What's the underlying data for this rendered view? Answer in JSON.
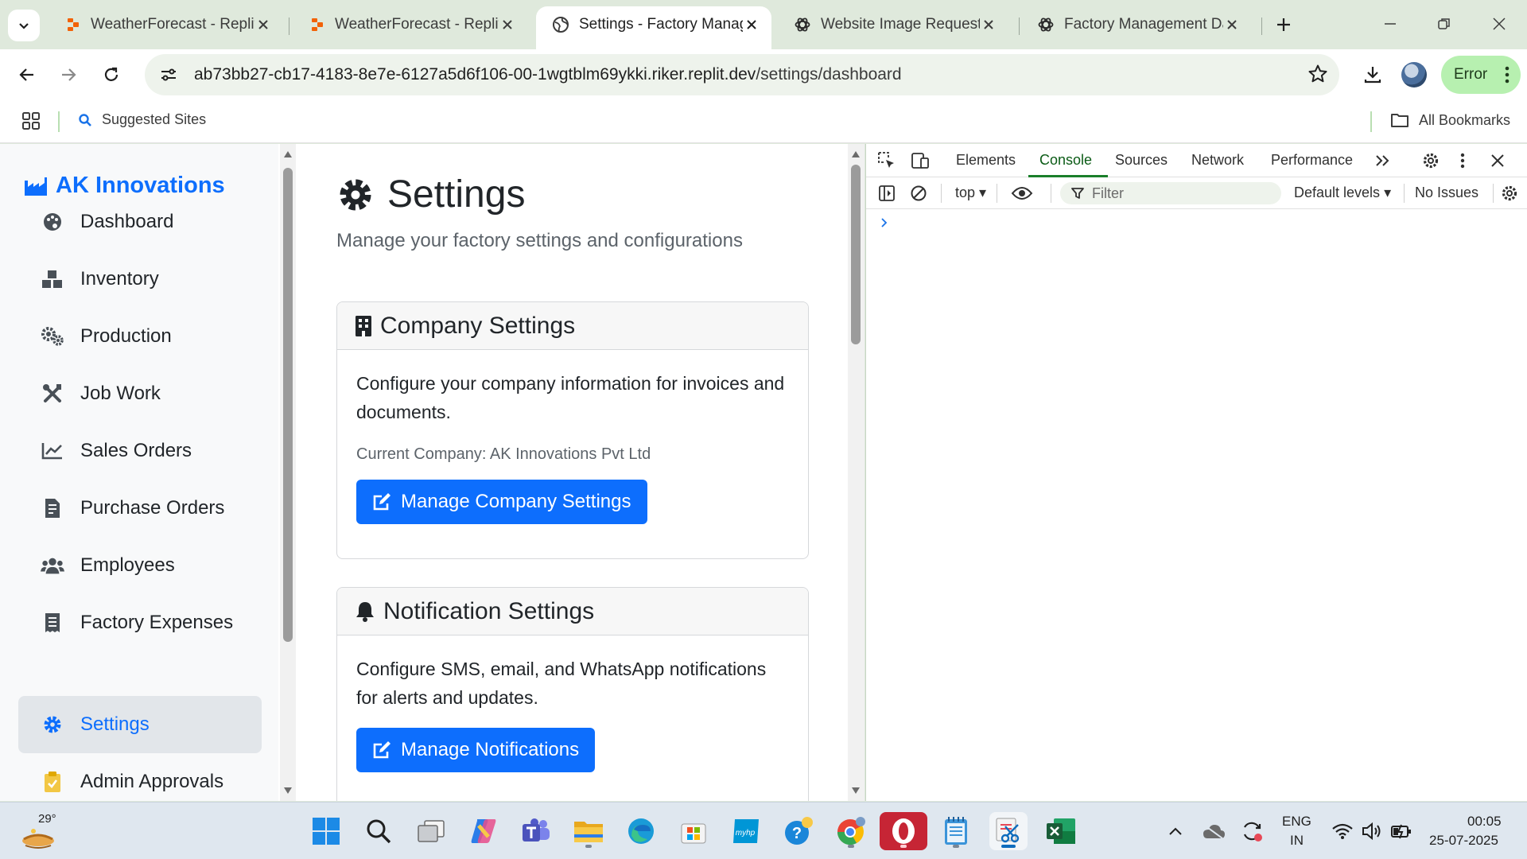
{
  "browser": {
    "tabs": [
      {
        "title": "WeatherForecast - Replit",
        "icon": "replit-icon",
        "active": false
      },
      {
        "title": "WeatherForecast - Replit",
        "icon": "replit-icon",
        "active": false
      },
      {
        "title": "Settings - Factory Manag",
        "icon": "globe-icon",
        "active": true
      },
      {
        "title": "Website Image Request",
        "icon": "chatgpt-icon",
        "active": false
      },
      {
        "title": "Factory Management Dat",
        "icon": "chatgpt-icon",
        "active": false
      }
    ],
    "url_host": "ab73bb27-cb17-4183-8e7e-6127a5d6f106-00-1wgtblm69ykki.riker.replit.dev",
    "url_path": "/settings/dashboard",
    "error_label": "Error",
    "bookmarks": {
      "suggested": "Suggested Sites",
      "all": "All Bookmarks"
    }
  },
  "app": {
    "brand": "AK Innovations",
    "nav": [
      {
        "label": "Dashboard",
        "icon": "palette-icon"
      },
      {
        "label": "Inventory",
        "icon": "boxes-icon"
      },
      {
        "label": "Production",
        "icon": "gears-icon"
      },
      {
        "label": "Job Work",
        "icon": "tools-icon"
      },
      {
        "label": "Sales Orders",
        "icon": "chart-line-icon"
      },
      {
        "label": "Purchase Orders",
        "icon": "file-invoice-icon"
      },
      {
        "label": "Employees",
        "icon": "users-icon"
      },
      {
        "label": "Factory Expenses",
        "icon": "receipt-icon"
      },
      {
        "label": "Settings",
        "icon": "gear-icon",
        "active": true
      },
      {
        "label": "Admin Approvals",
        "icon": "clipboard-check-icon"
      }
    ],
    "page_title": "Settings",
    "page_subtitle": "Manage your factory settings and configurations",
    "cards": {
      "company": {
        "title": "Company Settings",
        "text": "Configure your company information for invoices and documents.",
        "current": "Current Company: AK Innovations Pvt Ltd",
        "button": "Manage Company Settings"
      },
      "notifications": {
        "title": "Notification Settings",
        "text": "Configure SMS, email, and WhatsApp notifications for alerts and updates.",
        "button": "Manage Notifications"
      }
    }
  },
  "devtools": {
    "tabs": [
      "Elements",
      "Console",
      "Sources",
      "Network",
      "Performance"
    ],
    "active_tab": "Console",
    "context": "top",
    "filter_placeholder": "Filter",
    "levels": "Default levels",
    "issues": "No Issues"
  },
  "taskbar": {
    "temperature": "29°",
    "lang_top": "ENG",
    "lang_bottom": "IN",
    "time": "00:05",
    "date": "25-07-2025"
  },
  "colors": {
    "accent": "#0d6efd",
    "chrome_frame": "#dfe9dc",
    "error_pill": "#b7f0b0",
    "devtools_active": "#1a7f2a"
  }
}
